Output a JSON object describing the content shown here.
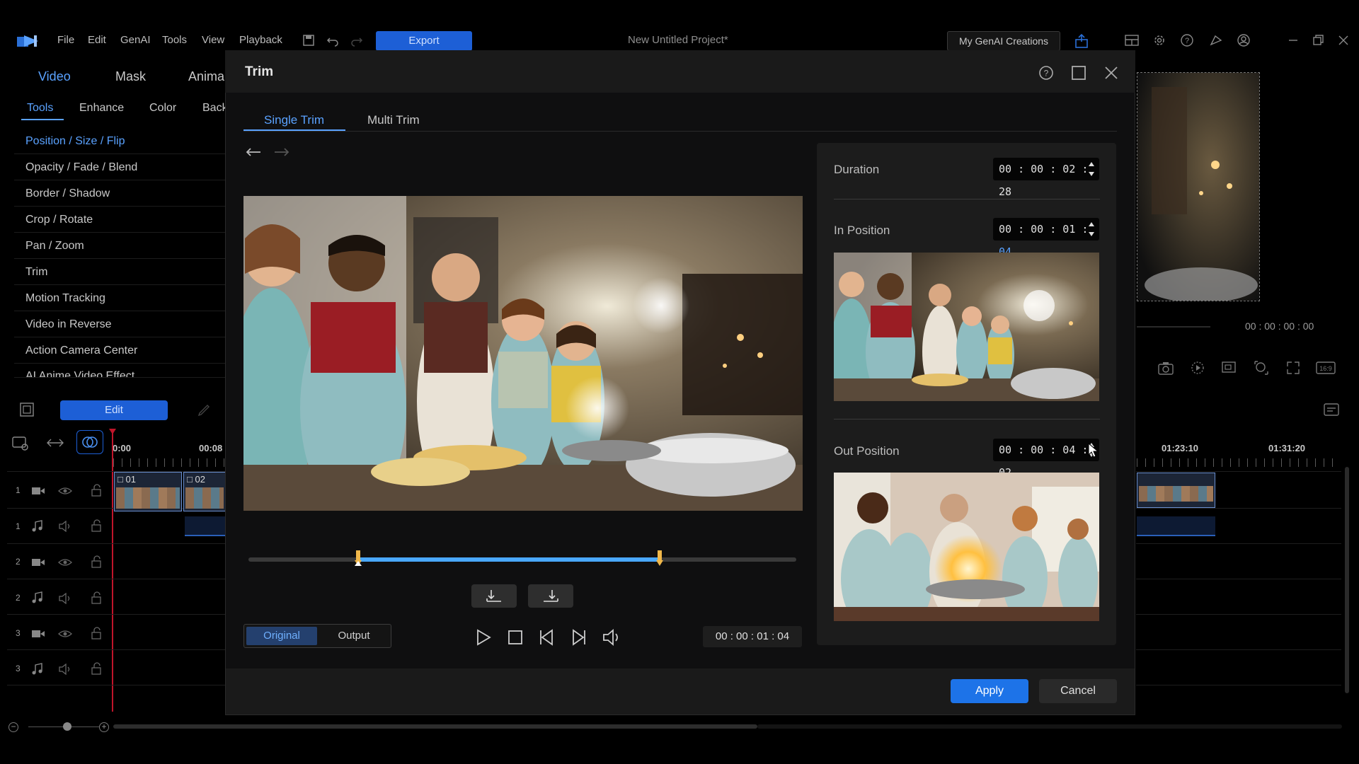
{
  "app": {
    "menu": [
      "File",
      "Edit",
      "GenAI",
      "Tools",
      "View",
      "Playback"
    ],
    "export_label": "Export",
    "project_title": "New Untitled Project*",
    "genai_creations_label": "My GenAI Creations"
  },
  "left_panel": {
    "tabs": [
      "Video",
      "Mask",
      "Anima"
    ],
    "subtabs": [
      "Tools",
      "Enhance",
      "Color",
      "Back"
    ],
    "tools": [
      "Position / Size / Flip",
      "Opacity / Fade / Blend",
      "Border / Shadow",
      "Crop / Rotate",
      "Pan / Zoom",
      "Trim",
      "Motion Tracking",
      "Video in Reverse",
      "Action Camera Center",
      "AI Anime Video Effect"
    ],
    "edit_label": "Edit"
  },
  "timeline": {
    "ruler_labels": [
      "0:00",
      "00:08"
    ],
    "right_ruler_labels": [
      "01:23:10",
      "01:31:20"
    ],
    "clips": [
      "01",
      "02"
    ],
    "track_numbers": [
      "1",
      "1",
      "2",
      "2",
      "3",
      "3"
    ]
  },
  "preview": {
    "timecode": "00 : 00 : 00 : 00"
  },
  "dialog": {
    "title": "Trim",
    "tabs": [
      "Single Trim",
      "Multi Trim"
    ],
    "duration_label": "Duration",
    "duration_value": "00 : 00 : 02 : 28",
    "in_label": "In Position",
    "in_value_prefix": "00 : 00 : 01 : ",
    "in_value_frames": "04",
    "out_label": "Out Position",
    "out_value": "00 : 00 : 04 : 02",
    "view_options": [
      "Original",
      "Output"
    ],
    "current_time": "00 : 00 : 01 : 04",
    "apply_label": "Apply",
    "cancel_label": "Cancel",
    "trim_range": {
      "in_fraction": 0.2,
      "out_fraction": 0.75
    }
  },
  "colors": {
    "accent": "#1d5fd6",
    "tab_active": "#5aa2ff",
    "trim_bar": "#4aa8ff",
    "marker": "#f0b74a"
  }
}
